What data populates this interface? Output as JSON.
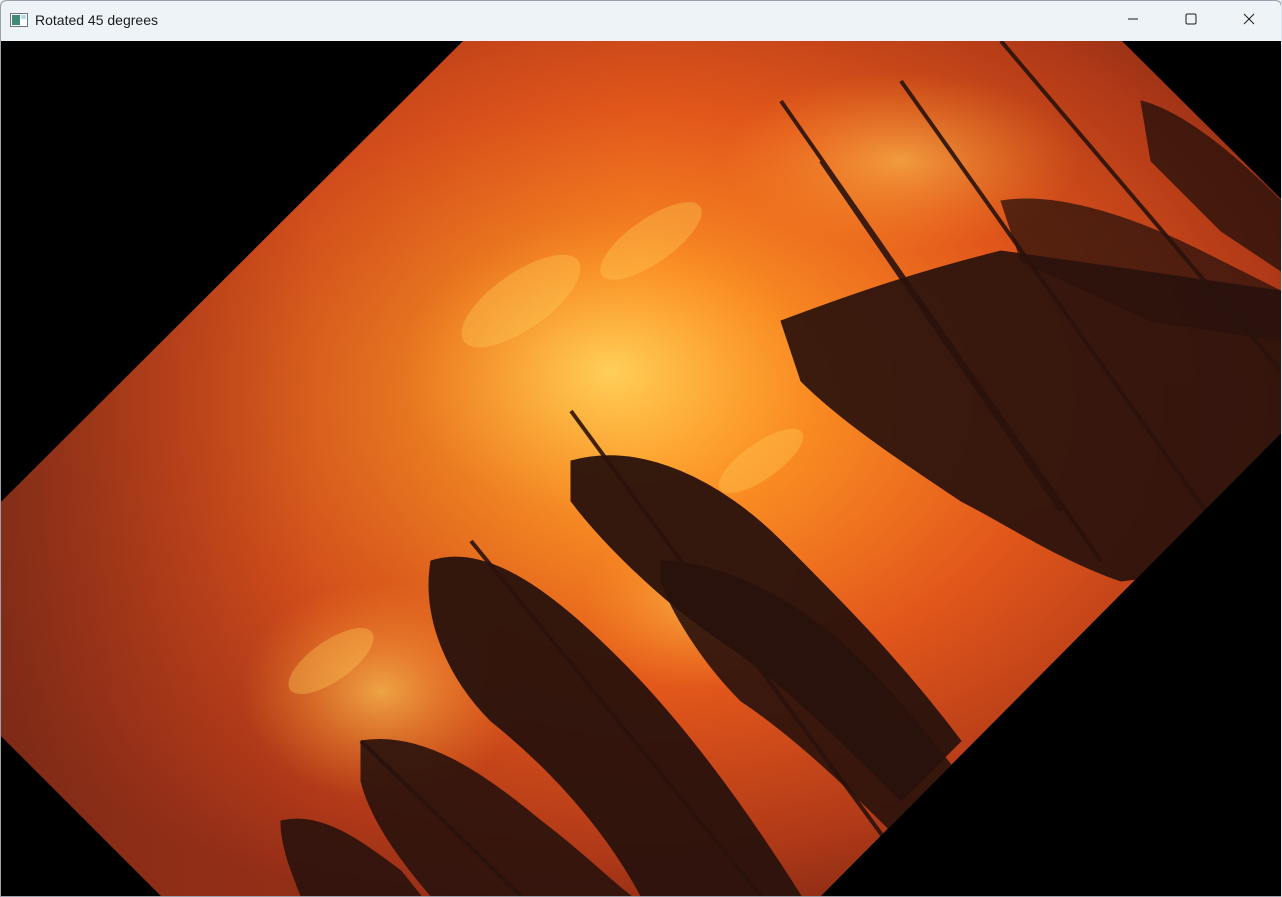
{
  "window": {
    "title": "Rotated 45 degrees",
    "icon": "image-viewer-app-icon",
    "controls": {
      "minimize_icon": "minimize-icon",
      "maximize_icon": "maximize-icon",
      "close_icon": "close-icon"
    }
  },
  "image": {
    "subject": "forest-fire-photo",
    "rotation": "45 degrees",
    "background": "#000000",
    "colors": {
      "fire_bright": "#ffb43a",
      "fire_mid": "#f26a1b",
      "fire_dark": "#a8331a",
      "smoke": "#7a2a17",
      "tree_silhouette": "#2a120c"
    }
  }
}
